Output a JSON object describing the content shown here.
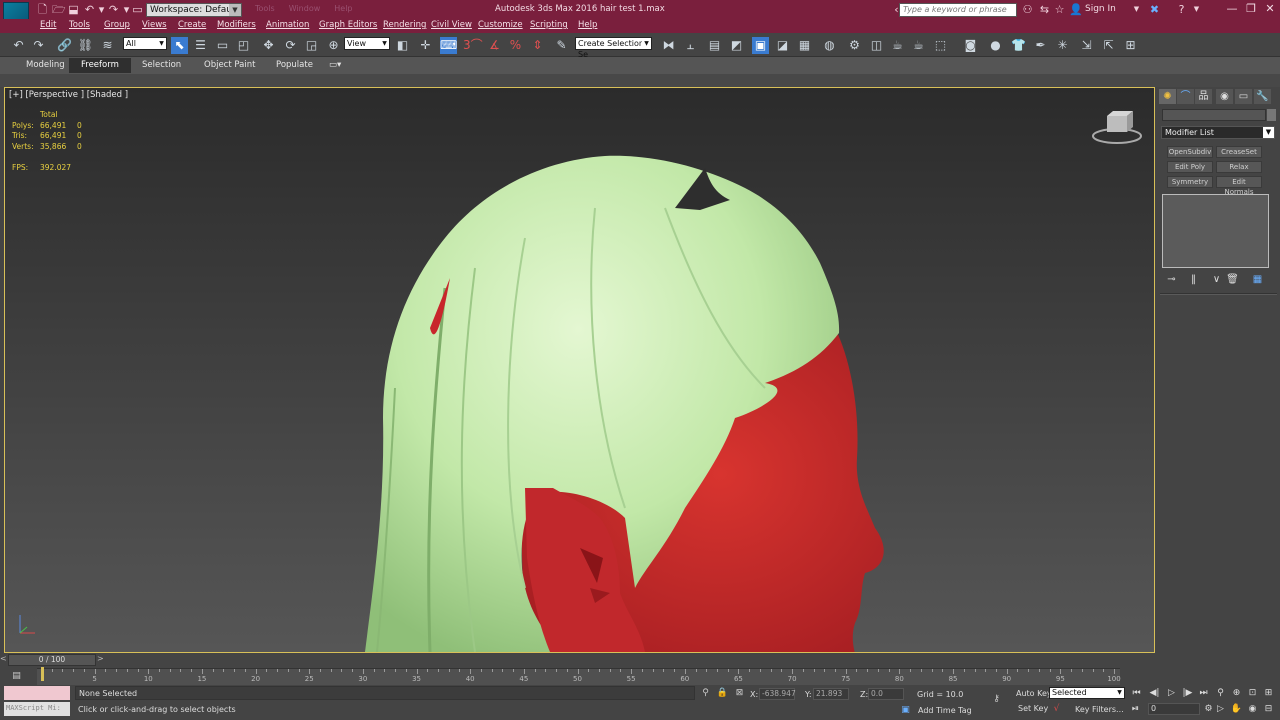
{
  "title_bar": {
    "app_logo_text": "MAX",
    "workspace": "Workspace: Default",
    "window_title": "Autodesk 3ds Max 2016      hair test 1.max",
    "search_placeholder": "Type a keyword or phrase",
    "sign_in": "Sign In",
    "ghost_menu": [
      "Tools",
      "Window",
      "Help"
    ]
  },
  "menu": [
    "Edit",
    "Tools",
    "Group",
    "Views",
    "Create",
    "Modifiers",
    "Animation",
    "Graph Editors",
    "Rendering",
    "Civil View",
    "Customize",
    "Scripting",
    "Help"
  ],
  "toolbar": {
    "selection_filter": "All",
    "reference_coord": "View",
    "named_selection": "Create Selection Se"
  },
  "ribbon": {
    "tabs": [
      "Modeling",
      "Freeform",
      "Selection",
      "Object Paint",
      "Populate"
    ],
    "active_tab": "Freeform"
  },
  "viewport": {
    "label": "[+] [Perspective ] [Shaded ]",
    "stats": {
      "header": "Total",
      "rows": [
        {
          "label": "Polys:",
          "total": "66,491",
          "sel": "0"
        },
        {
          "label": "Tris:",
          "total": "66,491",
          "sel": "0"
        },
        {
          "label": "Verts:",
          "total": "35,866",
          "sel": "0"
        }
      ],
      "fps_label": "FPS:",
      "fps_value": "392.027"
    },
    "colors": {
      "hair": "#c2e8a8",
      "skin": "#c8262b",
      "background_top": "#2c2c2c",
      "background_bottom": "#555555"
    }
  },
  "command_panel": {
    "modifier_list": "Modifier List",
    "buttons": [
      "OpenSubdiv",
      "CreaseSet",
      "Edit Poly",
      "Relax",
      "Symmetry",
      "Edit Normals"
    ]
  },
  "timeline": {
    "frame": "0 / 100",
    "ticks": [
      5,
      10,
      15,
      20,
      25,
      30,
      35,
      40,
      45,
      50,
      55,
      60,
      65,
      70,
      75,
      80,
      85,
      90,
      95,
      100
    ]
  },
  "status": {
    "maxscript": "MAXScript Mi:",
    "selection": "None Selected",
    "prompt": "Click or click-and-drag to select objects",
    "x_label": "X:",
    "x_value": "-638.947",
    "y_label": "Y:",
    "y_value": "21.893",
    "z_label": "Z:",
    "z_value": "0.0",
    "grid": "Grid = 10.0",
    "add_time_tag": "Add Time Tag",
    "auto_key": "Auto Key",
    "set_key": "Set Key",
    "key_mode": "Selected",
    "key_filters": "Key Filters...",
    "current_frame": "0"
  }
}
